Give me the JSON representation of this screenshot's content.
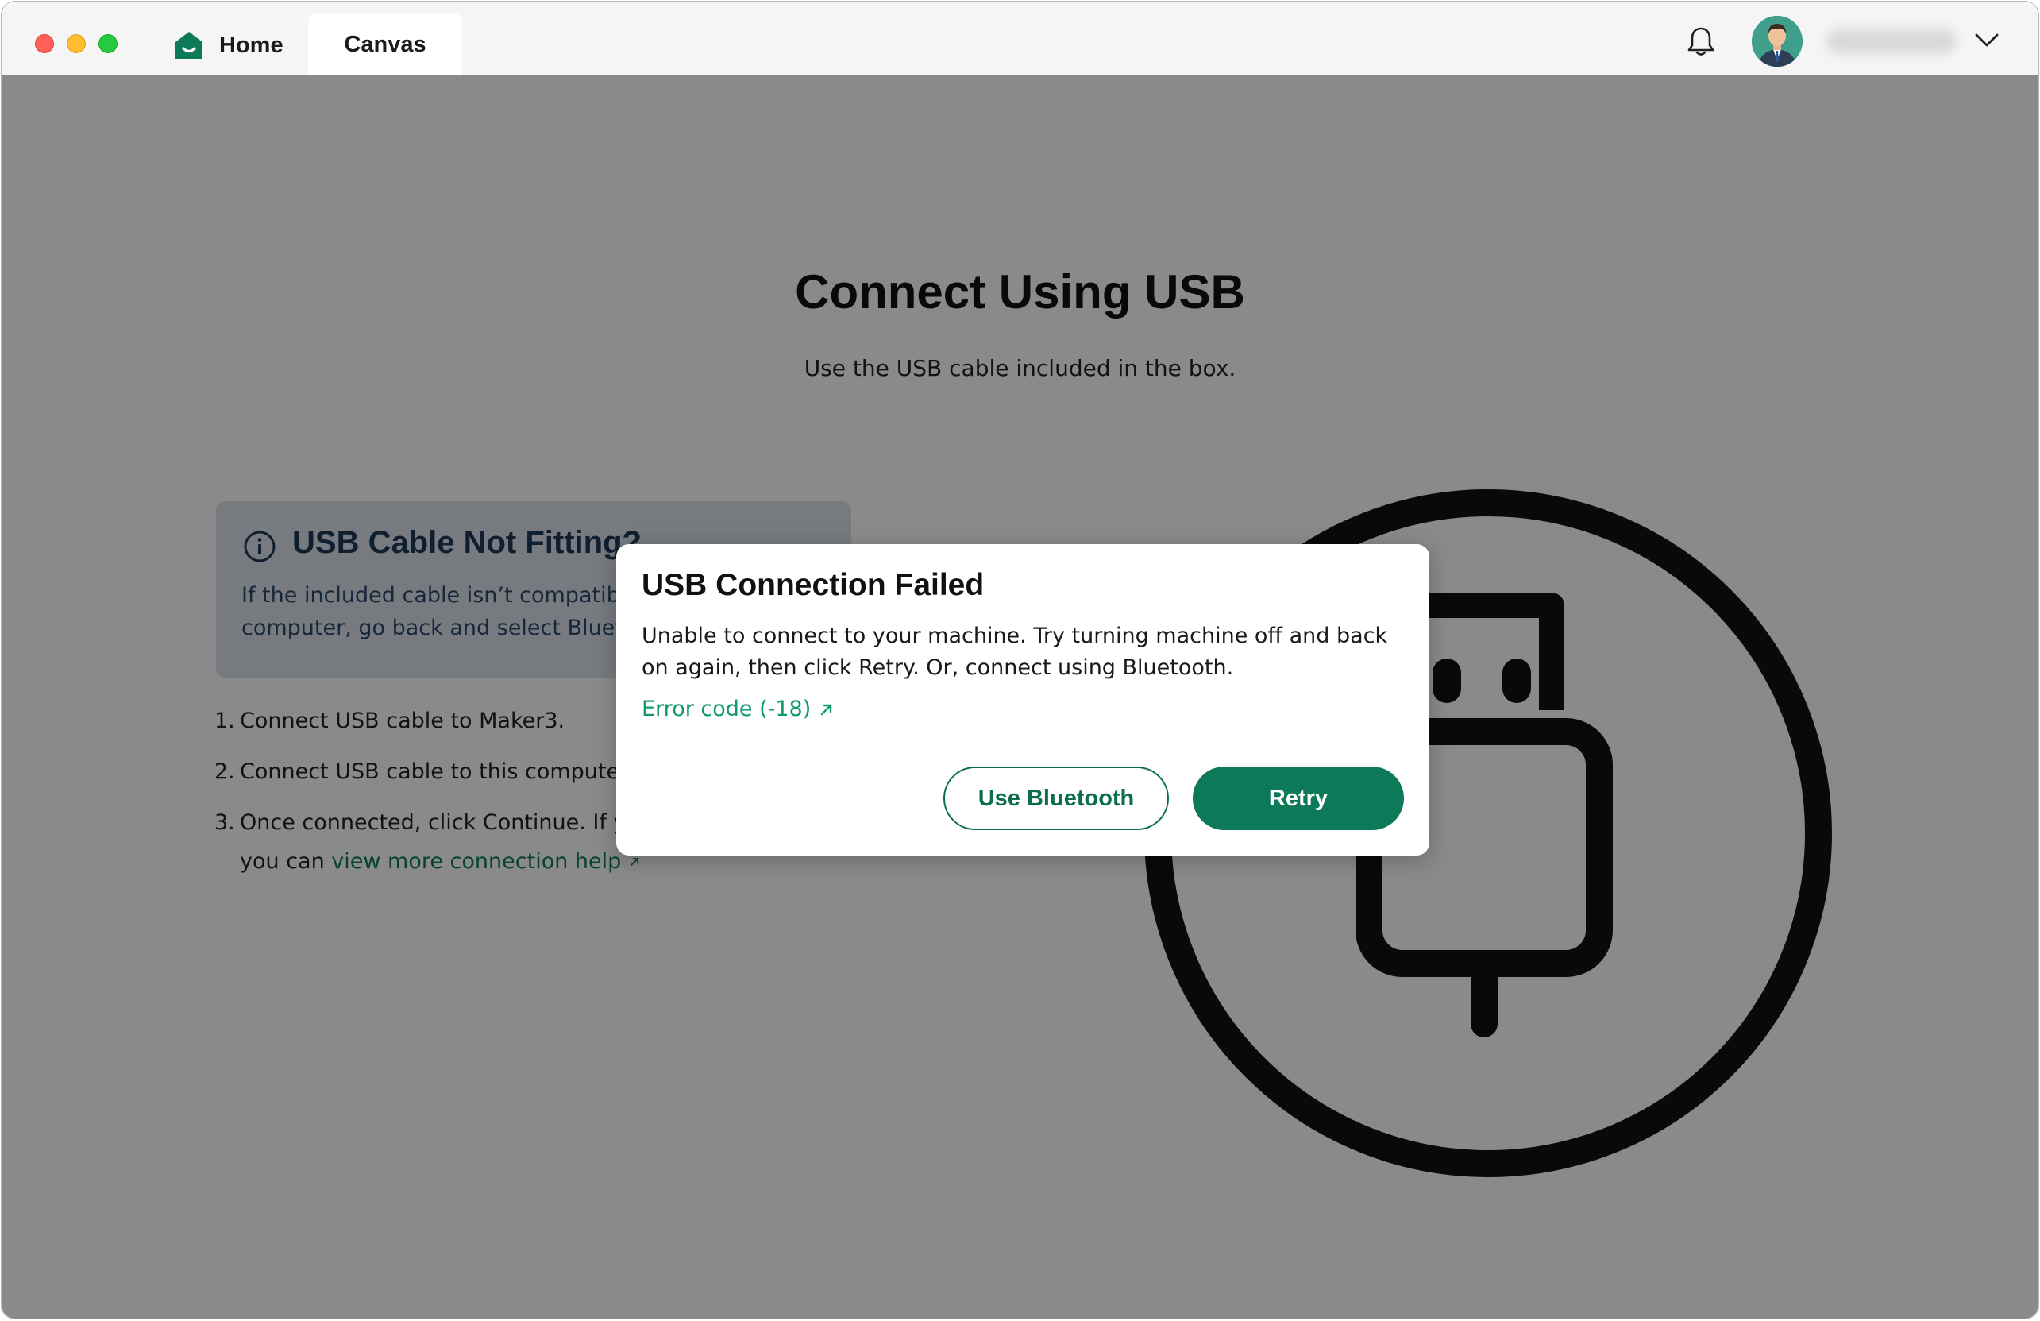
{
  "window": {
    "tabs": [
      {
        "label": "Home",
        "icon": "home-icon"
      },
      {
        "label": "Canvas",
        "active": true
      }
    ],
    "accent_color": "#0c7a58"
  },
  "page": {
    "title": "Connect Using USB",
    "subtitle": "Use the USB cable included in the box.",
    "info_card": {
      "icon": "info-icon",
      "heading": "USB Cable Not Fitting?",
      "body_line1": "If the included cable isn’t compatible with your",
      "body_line2": "computer, go back and select Bluetooth."
    },
    "steps": [
      {
        "num": "1.",
        "text": "Connect USB cable to Maker3."
      },
      {
        "num": "2.",
        "text": "Connect USB cable to this computer."
      },
      {
        "num": "3.",
        "line1": "Once connected, click Continue. If you need help,",
        "line2_prefix": "you can ",
        "link": "view more connection help"
      }
    ]
  },
  "dialog": {
    "title": "USB Connection Failed",
    "message": "Unable to connect to your machine. Try turning machine off and back on again, then click Retry. Or, connect using Bluetooth.",
    "error_link": "Error code (-18)",
    "secondary_button": "Use Bluetooth",
    "primary_button": "Retry"
  }
}
